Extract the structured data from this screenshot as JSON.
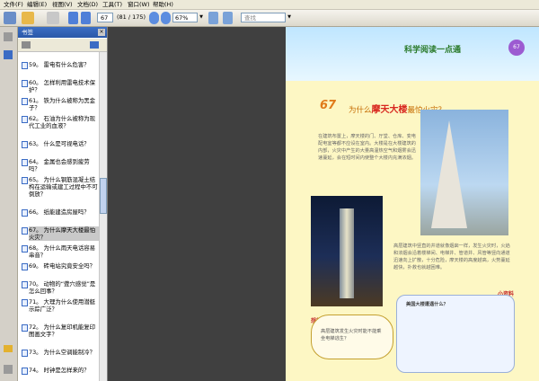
{
  "menu": {
    "items": [
      "文件(F)",
      "编辑(E)",
      "视图(V)",
      "文档(D)",
      "工具(T)",
      "窗口(W)",
      "帮助(H)"
    ]
  },
  "toolbar": {
    "page_current": "67",
    "page_total": "(81 / 175)",
    "zoom": "67%",
    "search_placeholder": "查找"
  },
  "bookmarks_panel": {
    "title": "书签",
    "close": "×",
    "items": [
      {
        "label": "59。 雷电有什么危害？",
        "selected": false
      },
      {
        "label": "60。 怎样利用雷电技术保护？",
        "selected": false
      },
      {
        "label": "61。 铁为什么被称为黑金子？",
        "selected": false
      },
      {
        "label": "62。 石油为什么被称为现代工业的血液？",
        "selected": false
      },
      {
        "label": "63。 什么是可视电话？",
        "selected": false
      },
      {
        "label": "64。 金属也会感到疲劳吗？",
        "selected": false
      },
      {
        "label": "65。 为什么钢筋混凝土结构在运输或建工过程中不可倒放？",
        "selected": false
      },
      {
        "label": "66。 纸能建造房屋吗？",
        "selected": false
      },
      {
        "label": "67。 为什么摩天大楼最怕火灾？",
        "selected": true
      },
      {
        "label": "68。 为什么雨天电话容易串音？",
        "selected": false
      },
      {
        "label": "69。 砖电站究竟安全吗？",
        "selected": false
      },
      {
        "label": "70。 动物的“聋穴感觉”是怎么回事？",
        "selected": false
      },
      {
        "label": "71。 大理为什么使用潜艇示踪广泛？",
        "selected": false
      },
      {
        "label": "72。 为什么复印机能复印图画文字？",
        "selected": false
      },
      {
        "label": "73。 为什么空调能制冷？",
        "selected": false
      },
      {
        "label": "74。 时钟是怎样来的？",
        "selected": false
      }
    ]
  },
  "document": {
    "header_title": "科学阅读一点通",
    "page_badge": "67",
    "chapter_number": "67",
    "chapter_title_pre": "为什么",
    "chapter_title_hl": "摩天大楼",
    "chapter_title_post": "最怕火灾？",
    "para1": "在建筑布置上，摩天楼的门、厅堂、仓库、变电配电室等都不应设在室内。大楼是在大楼建筑的内部，火灾中产生的大量高温热空气和烟雾会迅速蔓延，会在短时间内使整个大楼内充满浓烟。",
    "para2": "高层建筑中竖直的井道就像烟囱一样，发生火灾时，火焰和浓烟会沿着楼梯间、电梯井、管道井、风管等竖向通道迅速向上扩散，十分危险，摩天楼的高度越高，火势蔓延越快，扑救也就越困难。",
    "tag_left": "想想看",
    "tag_right": "小资料",
    "callout_title": "美国大楼遭遇什么？",
    "leftnote_text": "高层建筑发生火灾时能不能乘坐电梯逃生？"
  }
}
